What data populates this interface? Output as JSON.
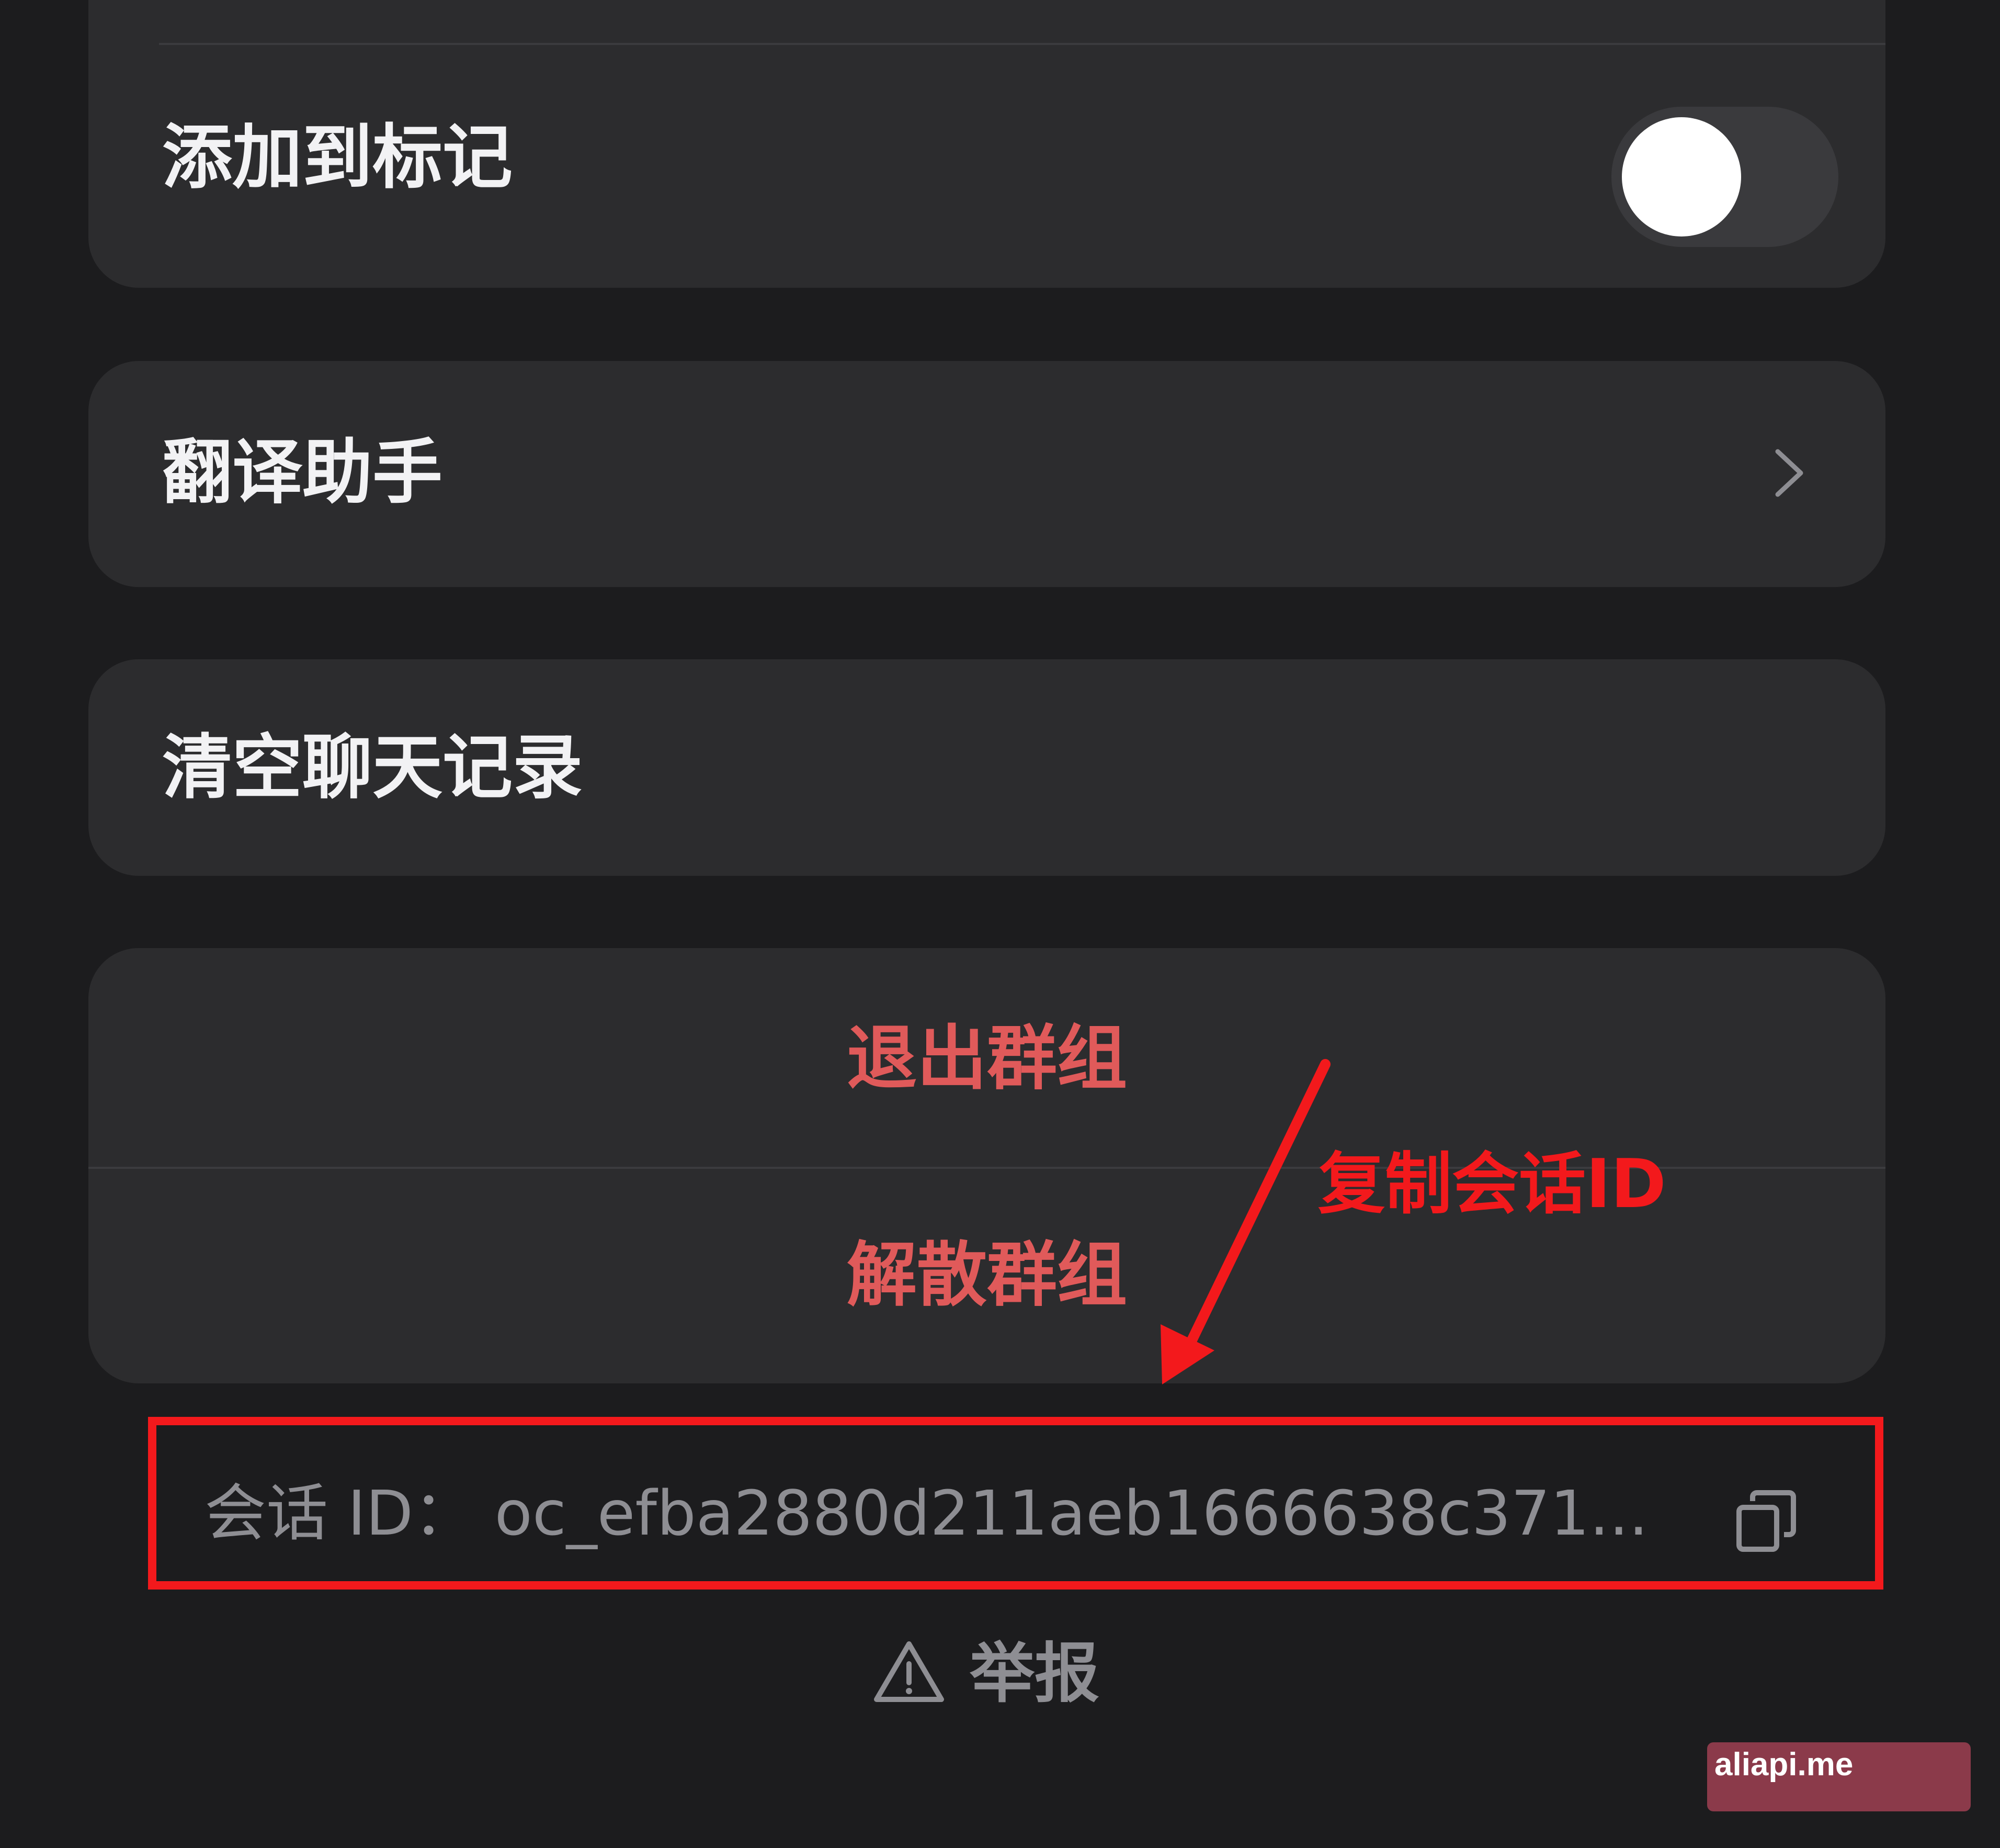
{
  "settings": {
    "add_to_marks": {
      "label": "添加到标记",
      "toggle_on": false
    },
    "translation_assistant": {
      "label": "翻译助手"
    },
    "clear_history": {
      "label": "清空聊天记录"
    }
  },
  "danger_actions": {
    "leave_group": "退出群组",
    "dissolve_group": "解散群组"
  },
  "session": {
    "id_text": "会话 ID：  oc_efba2880d211aeb1666638c371...",
    "copy_icon": "copy-icon"
  },
  "report": {
    "label": "举报",
    "icon": "warning-triangle-icon"
  },
  "annotation": {
    "label": "复制会话ID",
    "color": "#f3191c"
  },
  "watermark": {
    "text": "aliapi.me"
  },
  "colors": {
    "background": "#1c1c1e",
    "card": "#2c2c2e",
    "danger_text": "#e05a5a",
    "secondary_text": "#8e8e93"
  }
}
